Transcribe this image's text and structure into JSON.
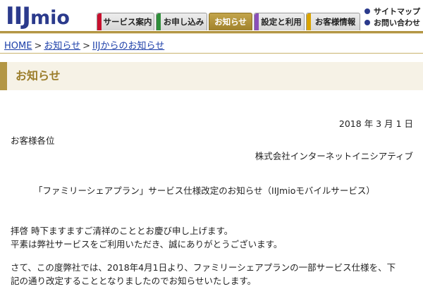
{
  "logo": {
    "ii": "IIJ",
    "mio": "mio"
  },
  "nav": {
    "tabs": [
      {
        "label": "サービス案内",
        "accent": "#c8102e",
        "active": false
      },
      {
        "label": "お申し込み",
        "accent": "#2f8f3a",
        "active": false
      },
      {
        "label": "お知らせ",
        "accent": "",
        "active": true
      },
      {
        "label": "設定と利用",
        "accent": "#8a4fb8",
        "active": false
      },
      {
        "label": "お客様情報",
        "accent": "#d9a400",
        "active": false
      }
    ],
    "util": {
      "sitemap": "サイトマップ",
      "contact": "お問い合わせ"
    }
  },
  "breadcrumb": {
    "home": "HOME",
    "news": "お知らせ",
    "iij_news": "IIJからのお知らせ",
    "separator": ">"
  },
  "page_title": "お知らせ",
  "letter": {
    "date": "2018 年 3 月 1 日",
    "recipient": "お客様各位",
    "sender": "株式会社インターネットイニシアティブ",
    "subject": "「ファミリーシェアプラン」サービス仕様改定のお知らせ（IIJmioモバイルサービス）",
    "greeting1": "拝啓 時下ますますご清祥のこととお慶び申し上げます。",
    "greeting2": "平素は弊社サービスをご利用いただき、誠にありがとうございます。",
    "body1": "さて、この度弊社では、2018年4月1日より、ファミリーシェアプランの一部サービス仕様を、下",
    "body2": "記の通り改定することとなりましたのでお知らせいたします。"
  }
}
